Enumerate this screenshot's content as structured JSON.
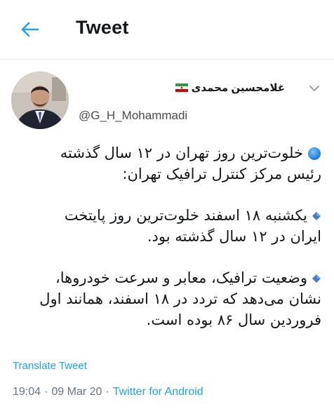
{
  "header": {
    "back_icon": "arrow-left-icon",
    "title": "Tweet"
  },
  "author": {
    "display_name": "غلامحسین محمدی",
    "flag_icon": "iran-flag-icon",
    "handle": "@G_H_Mohammadi",
    "avatar_icon": "profile-photo"
  },
  "more_icon": "chevron-down-icon",
  "tweet": {
    "paragraphs": [
      {
        "bullet": "blue-circle-emoji",
        "lines": [
          "خلوت‌ترین روز تهران در ۱۲ سال گذشته",
          "رئیس مرکز کنترل ترافیک تهران:"
        ]
      },
      {
        "bullet": "small-blue-diamond-emoji",
        "lines": [
          "یکشنبه ۱۸ اسفند خلوت‌ترین روز پایتخت",
          "ایران در ۱۲ سال گذشته بود."
        ]
      },
      {
        "bullet": "small-blue-diamond-emoji",
        "lines": [
          "وضعیت ترافیک، معابر و سرعت خودروها،",
          "نشان می‌دهد که تردد در ۱۸ اسفند، همانند اول",
          "فروردین سال ۸۶ بوده است."
        ]
      }
    ]
  },
  "translate_label": "Translate Tweet",
  "meta": {
    "time": "19:04",
    "separator": "·",
    "date": "09 Mar 20",
    "source": "Twitter for Android"
  },
  "colors": {
    "accent": "#1da1f2",
    "text": "#14171a",
    "secondary": "#657786",
    "divider": "#e6ecf0"
  }
}
